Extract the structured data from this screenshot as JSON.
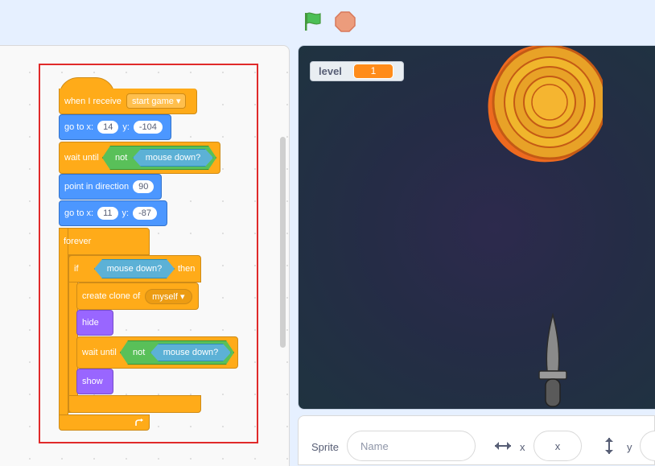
{
  "toolbar": {
    "flag_icon": "green-flag-icon",
    "stop_icon": "stop-icon"
  },
  "script": {
    "when_receive": "when I receive",
    "message": "start game",
    "goto1": {
      "label": "go to x:",
      "x": "14",
      "y_label": "y:",
      "y": "-104"
    },
    "wait_until_1": {
      "label": "wait until",
      "not": "not",
      "cond": "mouse down?"
    },
    "point_dir": {
      "label": "point in direction",
      "value": "90"
    },
    "goto2": {
      "label": "go to x:",
      "x": "11",
      "y_label": "y:",
      "y": "-87"
    },
    "forever": "forever",
    "if": {
      "label": "if",
      "cond": "mouse down?",
      "then": "then"
    },
    "create_clone": {
      "label": "create clone of",
      "target": "myself"
    },
    "hide": "hide",
    "wait_until_2": {
      "label": "wait until",
      "not": "not",
      "cond": "mouse down?"
    },
    "show": "show"
  },
  "stage": {
    "monitor_name": "level",
    "monitor_value": "1"
  },
  "sprite_panel": {
    "sprite_label": "Sprite",
    "name_placeholder": "Name",
    "x_label": "x",
    "x_placeholder": "x",
    "y_label": "y"
  },
  "colors": {
    "events": "#ffab19",
    "motion": "#4c97ff",
    "operators": "#59c059",
    "looks": "#9966ff",
    "sensing": "#5cb1d6"
  }
}
